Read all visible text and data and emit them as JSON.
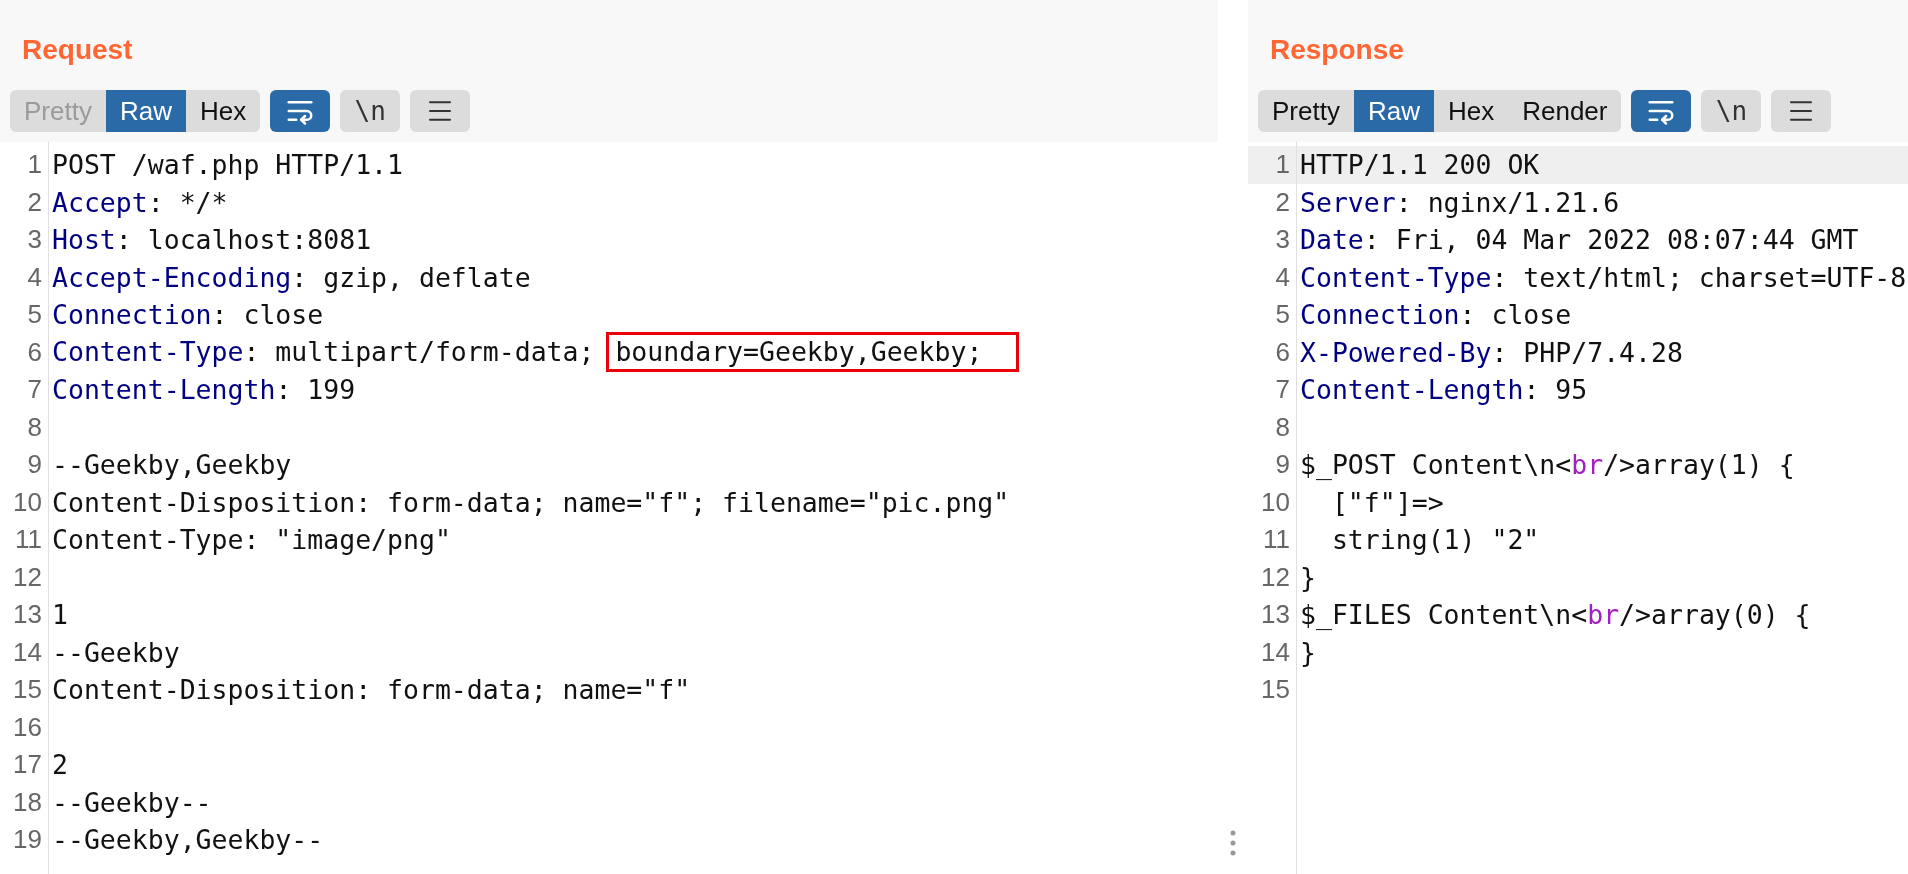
{
  "panels": [
    {
      "title": "Request",
      "tabs": [
        {
          "label": "Pretty",
          "selected": false,
          "disabled": true
        },
        {
          "label": "Raw",
          "selected": true,
          "disabled": false
        },
        {
          "label": "Hex",
          "selected": false,
          "disabled": false
        }
      ],
      "wrap_button": {
        "selected": true
      },
      "newline_button": {
        "label": "\\n",
        "selected": false
      },
      "menu_button": {
        "selected": false
      },
      "lines": [
        {
          "n": "1",
          "segments": [
            {
              "kind": "plain",
              "text": "POST /waf.php HTTP/1.1"
            }
          ]
        },
        {
          "n": "2",
          "segments": [
            {
              "kind": "key",
              "text": "Accept"
            },
            {
              "kind": "plain",
              "text": ": */*"
            }
          ]
        },
        {
          "n": "3",
          "segments": [
            {
              "kind": "key",
              "text": "Host"
            },
            {
              "kind": "plain",
              "text": ": localhost:8081"
            }
          ]
        },
        {
          "n": "4",
          "segments": [
            {
              "kind": "key",
              "text": "Accept-Encoding"
            },
            {
              "kind": "plain",
              "text": ": gzip, deflate"
            }
          ]
        },
        {
          "n": "5",
          "segments": [
            {
              "kind": "key",
              "text": "Connection"
            },
            {
              "kind": "plain",
              "text": ": close"
            }
          ]
        },
        {
          "n": "6",
          "segments": [
            {
              "kind": "key",
              "text": "Content-Type"
            },
            {
              "kind": "plain",
              "text": ": multipart/form-data; "
            },
            {
              "kind": "boxed",
              "text": "boundary=Geekby,Geekby;"
            }
          ]
        },
        {
          "n": "7",
          "segments": [
            {
              "kind": "key",
              "text": "Content-Length"
            },
            {
              "kind": "plain",
              "text": ": 199"
            }
          ]
        },
        {
          "n": "8"
        },
        {
          "n": "9",
          "segments": [
            {
              "kind": "plain",
              "text": "--Geekby,Geekby"
            }
          ]
        },
        {
          "n": "10",
          "segments": [
            {
              "kind": "plain",
              "text": "Content-Disposition: form-data; name=\"f\"; filename=\"pic.png\""
            }
          ]
        },
        {
          "n": "11",
          "segments": [
            {
              "kind": "plain",
              "text": "Content-Type: \"image/png\""
            }
          ]
        },
        {
          "n": "12"
        },
        {
          "n": "13",
          "segments": [
            {
              "kind": "plain",
              "text": "1"
            }
          ]
        },
        {
          "n": "14",
          "segments": [
            {
              "kind": "plain",
              "text": "--Geekby"
            }
          ]
        },
        {
          "n": "15",
          "segments": [
            {
              "kind": "plain",
              "text": "Content-Disposition: form-data; name=\"f\""
            }
          ]
        },
        {
          "n": "16"
        },
        {
          "n": "17",
          "segments": [
            {
              "kind": "plain",
              "text": "2"
            }
          ]
        },
        {
          "n": "18",
          "segments": [
            {
              "kind": "plain",
              "text": "--Geekby--"
            }
          ]
        },
        {
          "n": "19",
          "segments": [
            {
              "kind": "plain",
              "text": "--Geekby,Geekby--"
            }
          ]
        }
      ]
    },
    {
      "title": "Response",
      "tabs": [
        {
          "label": "Pretty",
          "selected": false,
          "disabled": false
        },
        {
          "label": "Raw",
          "selected": true,
          "disabled": false
        },
        {
          "label": "Hex",
          "selected": false,
          "disabled": false
        },
        {
          "label": "Render",
          "selected": false,
          "disabled": false
        }
      ],
      "wrap_button": {
        "selected": true
      },
      "newline_button": {
        "label": "\\n",
        "selected": false
      },
      "menu_button": {
        "selected": false
      },
      "lines": [
        {
          "n": "1",
          "highlighted": true,
          "segments": [
            {
              "kind": "plain",
              "text": "HTTP/1.1 200 OK"
            }
          ]
        },
        {
          "n": "2",
          "highlighted": false,
          "segments": [
            {
              "kind": "key",
              "text": "Server"
            },
            {
              "kind": "plain",
              "text": ": nginx/1.21.6"
            }
          ]
        },
        {
          "n": "3",
          "highlighted": false,
          "segments": [
            {
              "kind": "key",
              "text": "Date"
            },
            {
              "kind": "plain",
              "text": ": Fri, 04 Mar 2022 08:07:44 GMT"
            }
          ]
        },
        {
          "n": "4",
          "highlighted": false,
          "segments": [
            {
              "kind": "key",
              "text": "Content-Type"
            },
            {
              "kind": "plain",
              "text": ": text/html; charset=UTF-8"
            }
          ]
        },
        {
          "n": "5",
          "highlighted": false,
          "segments": [
            {
              "kind": "key",
              "text": "Connection"
            },
            {
              "kind": "plain",
              "text": ": close"
            }
          ]
        },
        {
          "n": "6",
          "highlighted": false,
          "segments": [
            {
              "kind": "key",
              "text": "X-Powered-By"
            },
            {
              "kind": "plain",
              "text": ": PHP/7.4.28"
            }
          ]
        },
        {
          "n": "7",
          "highlighted": false,
          "segments": [
            {
              "kind": "key",
              "text": "Content-Length"
            },
            {
              "kind": "plain",
              "text": ": 95"
            }
          ]
        },
        {
          "n": "8",
          "highlighted": false
        },
        {
          "n": "9",
          "highlighted": false,
          "segments": [
            {
              "kind": "plain",
              "text": "$_POST Content\\n<"
            },
            {
              "kind": "tag",
              "text": "br"
            },
            {
              "kind": "plain",
              "text": "/>array(1) {"
            }
          ]
        },
        {
          "n": "10",
          "highlighted": false,
          "segments": [
            {
              "kind": "plain",
              "text": "  [\"f\"]=>"
            }
          ]
        },
        {
          "n": "11",
          "highlighted": false,
          "segments": [
            {
              "kind": "plain",
              "text": "  string(1) \"2\""
            }
          ]
        },
        {
          "n": "12",
          "highlighted": false,
          "segments": [
            {
              "kind": "plain",
              "text": "}"
            }
          ]
        },
        {
          "n": "13",
          "highlighted": false,
          "segments": [
            {
              "kind": "plain",
              "text": "$_FILES Content\\n<"
            },
            {
              "kind": "tag",
              "text": "br"
            },
            {
              "kind": "plain",
              "text": "/>array(0) {"
            }
          ]
        },
        {
          "n": "14",
          "highlighted": false,
          "segments": [
            {
              "kind": "plain",
              "text": "}"
            }
          ]
        },
        {
          "n": "15",
          "highlighted": false
        }
      ]
    }
  ]
}
